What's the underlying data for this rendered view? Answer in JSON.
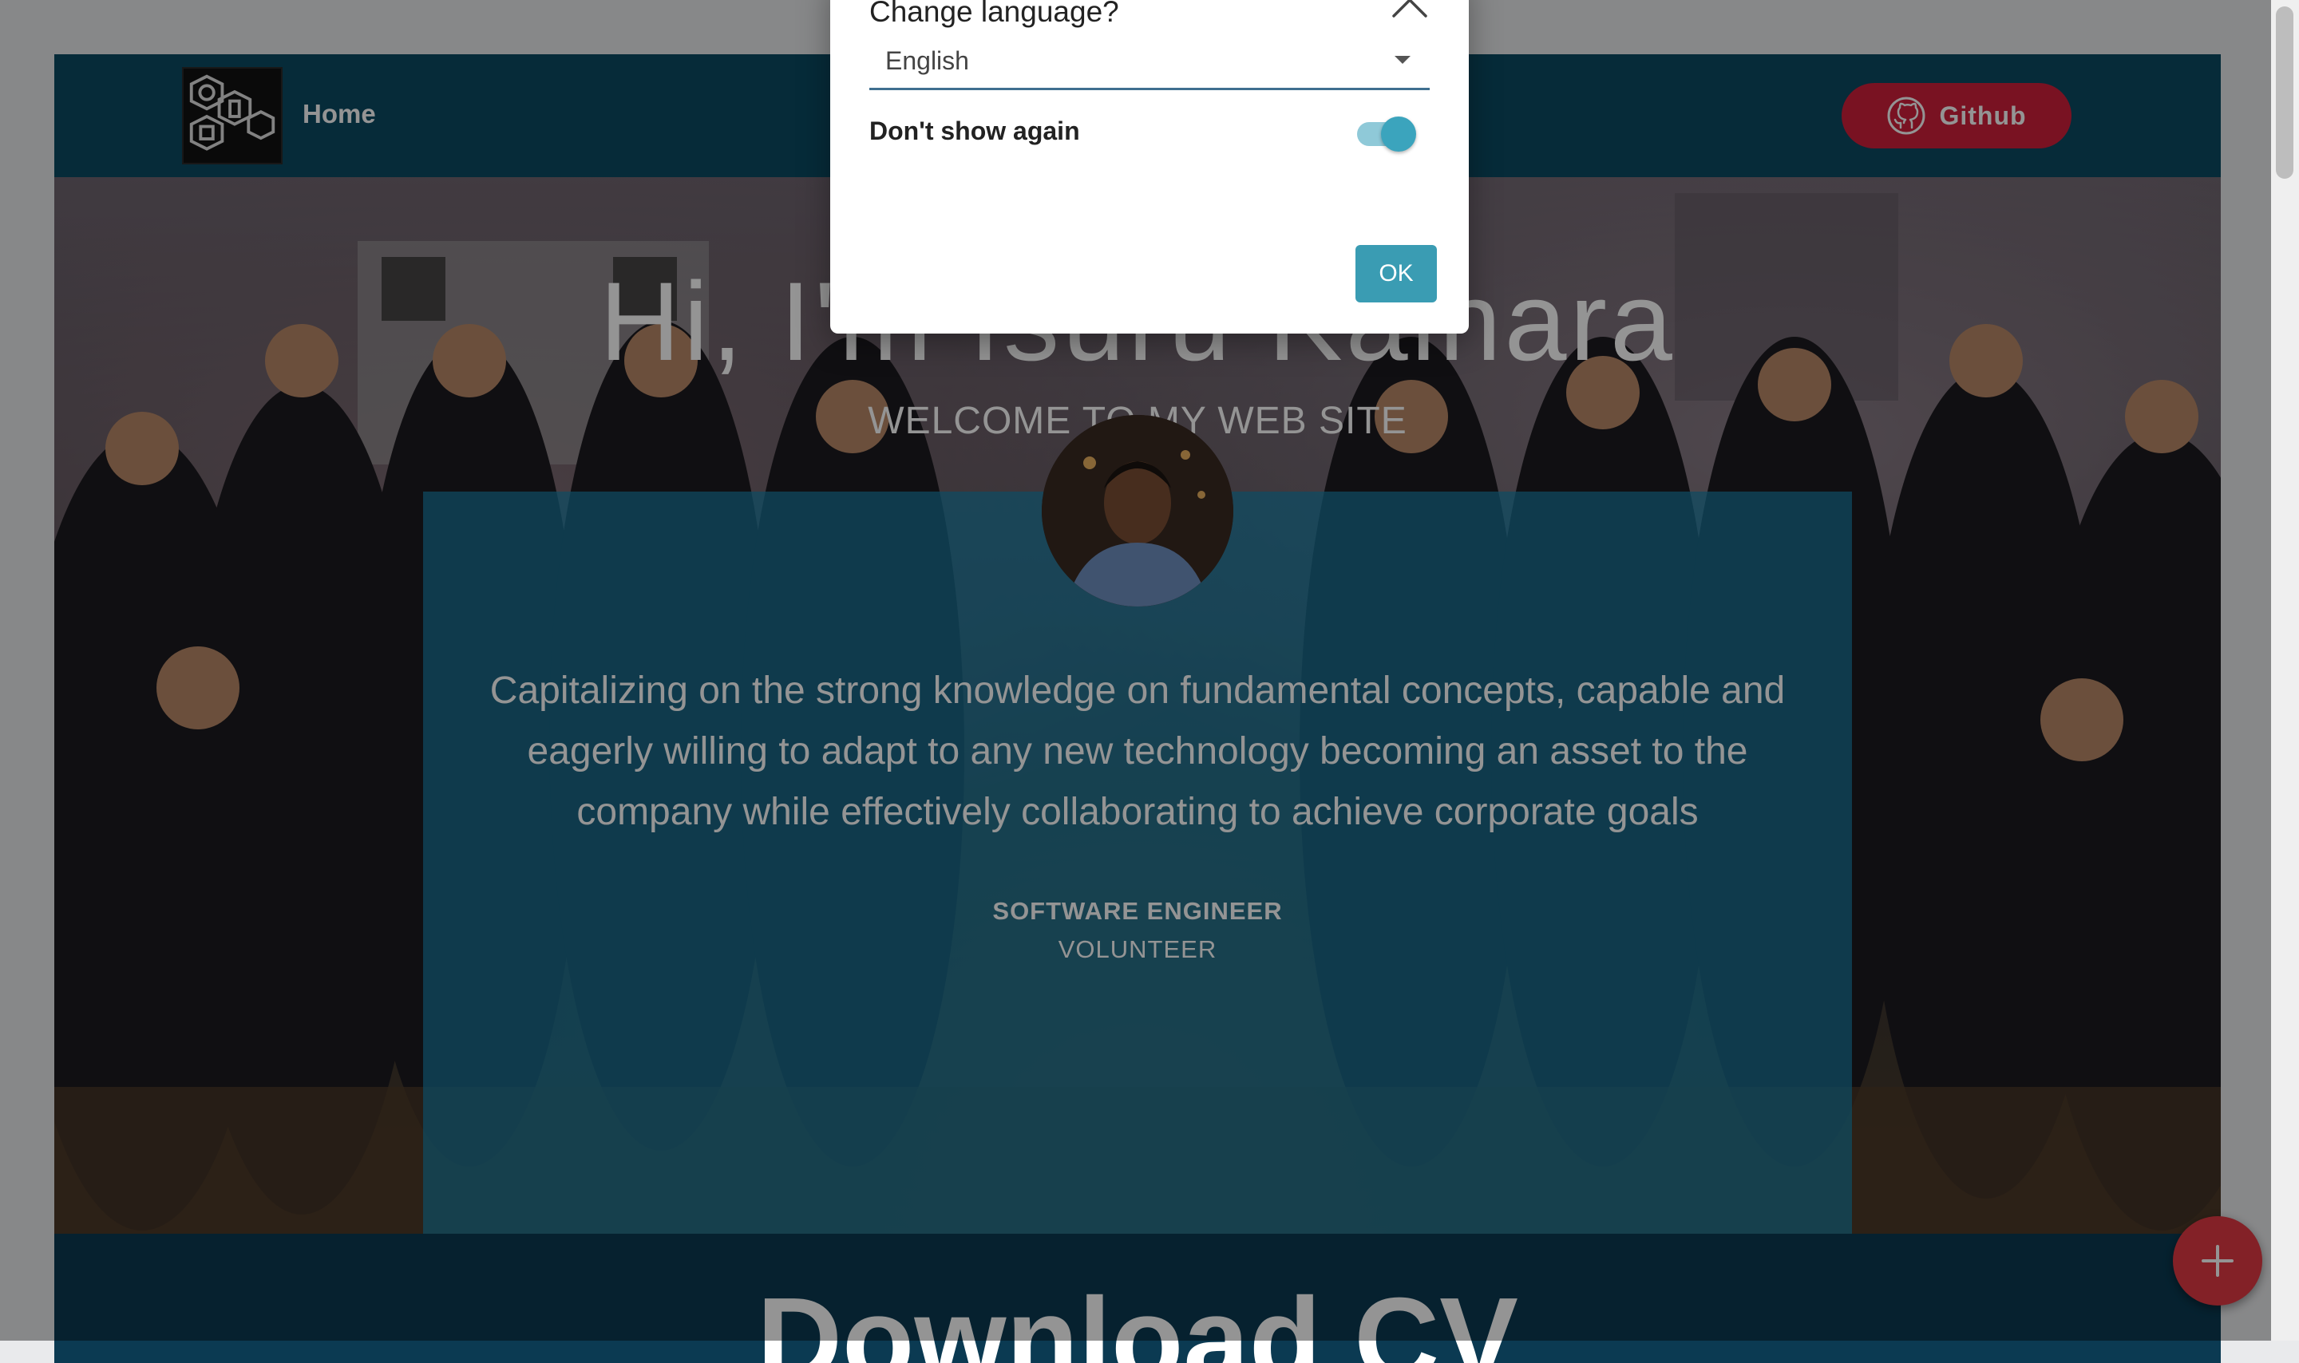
{
  "navbar": {
    "home_label": "Home",
    "github_label": "Github"
  },
  "hero": {
    "title": "Hi, I'm Isuru Kalhara",
    "subtitle": "WELCOME TO MY WEB SITE"
  },
  "profile": {
    "quote": "Capitalizing on the strong knowledge on fundamental concepts, capable and eagerly willing to adapt to any new technology becoming an asset to the company while effectively collaborating to achieve corporate goals",
    "role": "SOFTWARE ENGINEER",
    "secondary_role": "VOLUNTEER"
  },
  "download": {
    "title": "Download CV"
  },
  "dialog": {
    "title": "Change language?",
    "select": {
      "value": "English"
    },
    "toggle": {
      "label": "Don't show again",
      "checked": true
    },
    "ok_label": "OK"
  },
  "icons": {
    "logo": "hexagon-logo-icon",
    "github": "github-icon",
    "close": "chevron-up-icon",
    "dropdown": "caret-down-icon",
    "fab": "plus-icon"
  },
  "colors": {
    "navbar": "#0c4a63",
    "github_button": "#d01f3c",
    "card": "#1982aa",
    "accent": "#3a9cb3",
    "fab": "#e23a44"
  }
}
